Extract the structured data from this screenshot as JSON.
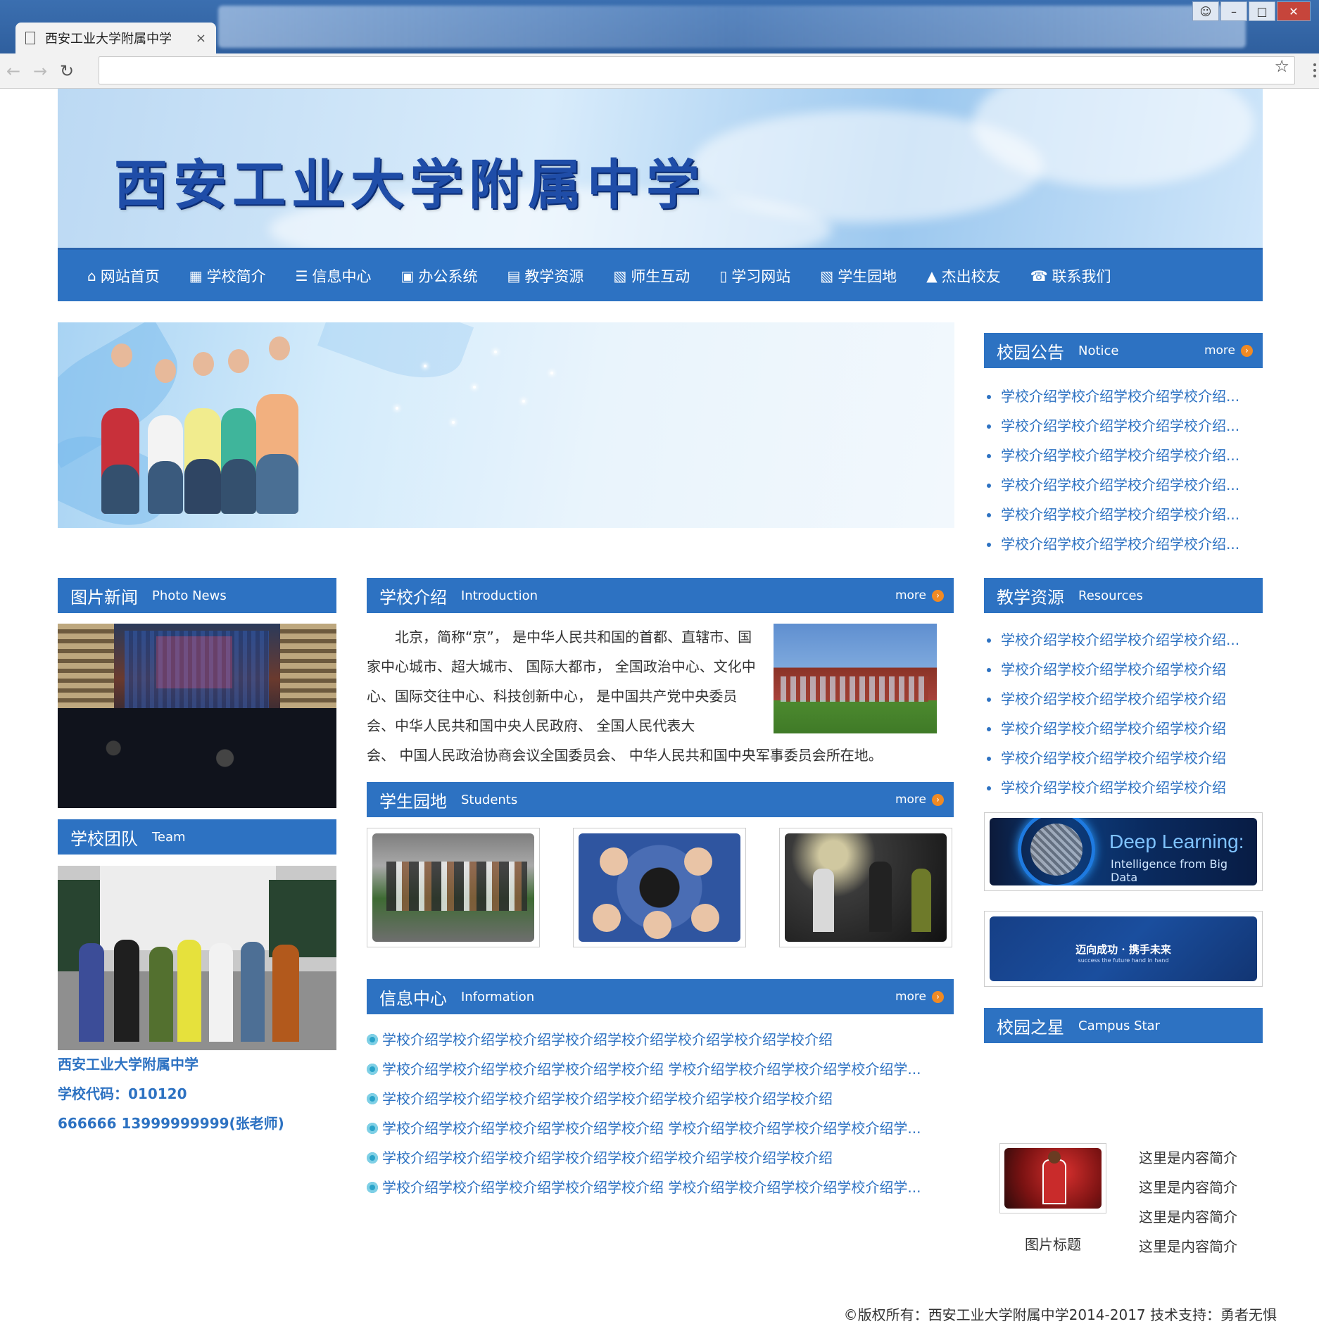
{
  "browser": {
    "tab_title": "西安工业大学附属中学",
    "close": "×",
    "url": ""
  },
  "banner": {
    "title": "西安工业大学附属中学"
  },
  "nav": [
    {
      "icon": "home-icon",
      "glyph": "⌂",
      "label": "网站首页"
    },
    {
      "icon": "grid-icon",
      "glyph": "▦",
      "label": "学校简介"
    },
    {
      "icon": "list-icon",
      "glyph": "☰",
      "label": "信息中心"
    },
    {
      "icon": "gift-icon",
      "glyph": "▣",
      "label": "办公系统"
    },
    {
      "icon": "calendar-icon",
      "glyph": "▤",
      "label": "教学资源"
    },
    {
      "icon": "picture-icon",
      "glyph": "▧",
      "label": "师生互动"
    },
    {
      "icon": "book-icon",
      "glyph": "▯",
      "label": "学习网站"
    },
    {
      "icon": "picture-icon",
      "glyph": "▧",
      "label": "学生园地"
    },
    {
      "icon": "graduation-cap-icon",
      "glyph": "▲",
      "label": "杰出校友"
    },
    {
      "icon": "phone-icon",
      "glyph": "☎",
      "label": "联系我们"
    }
  ],
  "notice": {
    "zh": "校园公告",
    "en": "Notice",
    "more": "more",
    "items": [
      "学校介绍学校介绍学校介绍学校介绍...",
      "学校介绍学校介绍学校介绍学校介绍...",
      "学校介绍学校介绍学校介绍学校介绍...",
      "学校介绍学校介绍学校介绍学校介绍...",
      "学校介绍学校介绍学校介绍学校介绍...",
      "学校介绍学校介绍学校介绍学校介绍..."
    ]
  },
  "photo_news": {
    "zh": "图片新闻",
    "en": "Photo News"
  },
  "team": {
    "zh": "学校团队",
    "en": "Team"
  },
  "intro": {
    "zh": "学校介绍",
    "en": "Introduction",
    "more": "more",
    "text_a": "北京，简称“京”， 是中华人民共和国的首都、直辖市、国家中心城市、超大城市、 国际大都市， 全国政治中心、文化中心、国际交往中心、科技创新中心， 是中国共产党中央委员会、中华人民共和国中央人民政府、 全国人民代表大",
    "text_b": "会、 中国人民政治协商会议全国委员会、 中华人民共和国中央军事委员会所在地。"
  },
  "students": {
    "zh": "学生园地",
    "en": "Students",
    "more": "more"
  },
  "information": {
    "zh": "信息中心",
    "en": "Information",
    "more": "more",
    "items": [
      "学校介绍学校介绍学校介绍学校介绍学校介绍学校介绍学校介绍学校介绍",
      "学校介绍学校介绍学校介绍学校介绍学校介绍 学校介绍学校介绍学校介绍学校介绍学...",
      "学校介绍学校介绍学校介绍学校介绍学校介绍学校介绍学校介绍学校介绍",
      "学校介绍学校介绍学校介绍学校介绍学校介绍 学校介绍学校介绍学校介绍学校介绍学...",
      "学校介绍学校介绍学校介绍学校介绍学校介绍学校介绍学校介绍学校介绍",
      "学校介绍学校介绍学校介绍学校介绍学校介绍 学校介绍学校介绍学校介绍学校介绍学..."
    ]
  },
  "resources": {
    "zh": "教学资源",
    "en": "Resources",
    "items": [
      "学校介绍学校介绍学校介绍学校介绍...",
      "学校介绍学校介绍学校介绍学校介绍",
      "学校介绍学校介绍学校介绍学校介绍",
      "学校介绍学校介绍学校介绍学校介绍",
      "学校介绍学校介绍学校介绍学校介绍",
      "学校介绍学校介绍学校介绍学校介绍"
    ]
  },
  "ads": {
    "deep_title": "Deep Learning:",
    "deep_sub": "Intelligence from Big Data",
    "slogan": "迈向成功 · 携手未来",
    "slogan_sub": "success the future hand in hand"
  },
  "campus_star": {
    "zh": "校园之星",
    "en": "Campus Star",
    "caption": "图片标题",
    "items": [
      "这里是内容简介",
      "这里是内容简介",
      "这里是内容简介",
      "这里是内容简介"
    ]
  },
  "school": {
    "name": "西安工业大学附属中学",
    "code": "学校代码：010120",
    "phone": "666666 13999999999(张老师)"
  },
  "footer": "©版权所有：西安工业大学附属中学2014-2017 技术支持：勇者无惧",
  "colors": {
    "accent": "#2d72c2",
    "more_arrow": "#f08a24"
  }
}
